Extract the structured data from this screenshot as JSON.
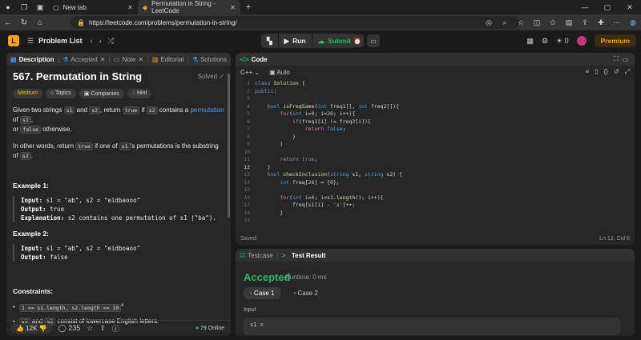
{
  "browser": {
    "tabs": [
      {
        "title": "New tab"
      },
      {
        "title": "Permutation in String - LeetCode"
      }
    ],
    "url": "https://leetcode.com/problems/permutation-in-string/"
  },
  "header": {
    "problem_list": "Problem List",
    "run": "Run",
    "submit": "Submit",
    "fire_count": "0",
    "premium": "Premium"
  },
  "left_tabs": [
    "Description",
    "Accepted",
    "Note",
    "Editorial",
    "Solutions"
  ],
  "problem": {
    "title": "567. Permutation in String",
    "status": "Solved",
    "tags": [
      "Medium",
      "Topics",
      "Companies",
      "Hint"
    ],
    "p1_a": "Given two strings ",
    "s1": "s1",
    "p1_b": " and ",
    "s2": "s2",
    "p1_c": ", return ",
    "true": "true",
    "p1_d": " if ",
    "p1_e": " contains a ",
    "permutation": "permutation",
    "p1_f": " of ",
    "p1_g": ",",
    "p1_h": "or ",
    "false": "false",
    "p1_i": " otherwise.",
    "p2_a": "In other words, return ",
    "p2_b": " if one of ",
    "p2_c": "'s permutations is the substring of ",
    "p2_d": ".",
    "examples": [
      {
        "heading": "Example 1:",
        "input_label": "Input:",
        "input": "s1 = \"ab\", s2 = \"eidbaooo\"",
        "output_label": "Output:",
        "output": "true",
        "expl_label": "Explanation:",
        "explanation": "s2 contains one permutation of s1 (\"ba\")."
      },
      {
        "heading": "Example 2:",
        "input_label": "Input:",
        "input": "s1 = \"ab\", s2 = \"eidboaoo\"",
        "output_label": "Output:",
        "output": "false"
      }
    ],
    "constraints_heading": "Constraints:",
    "constraint1": "1 <= s1.length, s2.length <= 10",
    "constraint1_sup": "4",
    "constraint2_s1": "s1",
    "constraint2_mid": " and ",
    "constraint2_s2": "s2",
    "constraint2_rest": " consist of lowercase English letters."
  },
  "footer_left": {
    "likes": "12K",
    "comments": "235",
    "online": "79 Online"
  },
  "editor": {
    "title": "Code",
    "language": "C++",
    "mode": "Auto",
    "status": "Saved",
    "cursor": "Ln 12, Col 6",
    "current_line": 12,
    "lines": [
      "class Solution {",
      "public:",
      "",
      "    bool isFreqSame(int freq1[], int freq2[]){",
      "        for(int i=0; i<26; i++){",
      "            if(freq1[i] != freq2[i]){",
      "                return false;",
      "            }",
      "        }",
      "",
      "        return true;",
      "    }",
      "    bool checkInclusion(string s1, string s2) {",
      "        int freq[26] = {0};",
      "",
      "        for(int i=0; i<s1.length(); i++){",
      "            freq[s1[i] - 'a']++;",
      "        }",
      ""
    ]
  },
  "result": {
    "tab_testcase": "Testcase",
    "tab_result": "Test Result",
    "verdict": "Accepted",
    "runtime": "Runtime: 0 ms",
    "cases": [
      "Case 1",
      "Case 2"
    ],
    "input_label": "Input",
    "input_preview": "s1 ="
  }
}
